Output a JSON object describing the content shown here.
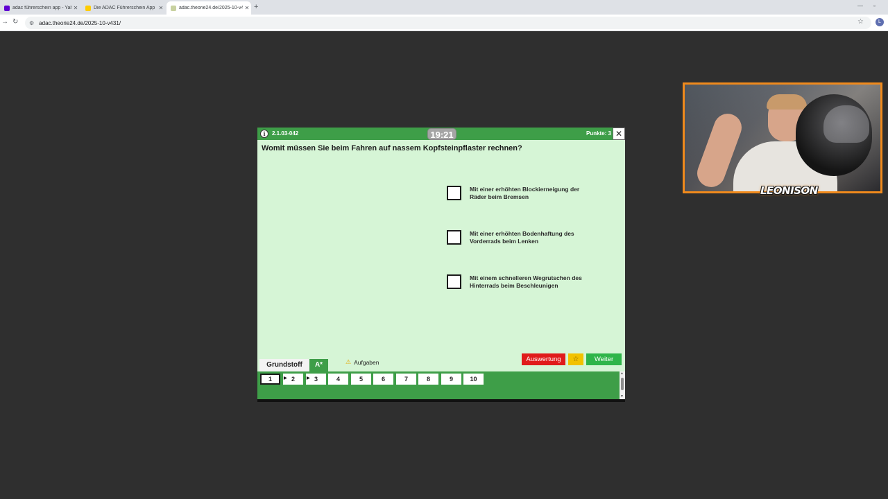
{
  "browser": {
    "tabs": [
      {
        "title": "adac führerschein app - Yahoo",
        "favicon_color": "#6001d2"
      },
      {
        "title": "Die ADAC Führerschein App",
        "favicon_color": "#ffcc00"
      },
      {
        "title": "adac.theorie24.de/2025-10-v4",
        "favicon_color": "#c8d1a0"
      }
    ],
    "active_tab": 2,
    "new_tab_label": "+",
    "close_label": "✕",
    "url": "adac.theorie24.de/2025-10-v431/",
    "profile_initial": "L"
  },
  "overlay": {
    "logo_text": "LEONISON",
    "border_color": "#f08a1c"
  },
  "exam": {
    "question_code": "2.1.03-042",
    "timer": "19:21",
    "points": "Punkte: 3",
    "close_label": "✕",
    "question": "Womit müssen Sie beim Fahren auf nassem Kopfsteinpflaster rechnen?",
    "answers": [
      {
        "text": "Mit einer erhöhten Blockierneigung der Räder beim Bremsen",
        "checked": false
      },
      {
        "text": "Mit einer erhöhten Bodenhaftung des Vorderrads beim Lenken",
        "checked": false
      },
      {
        "text": "Mit einem schnelleren Wegrutschen des Hinterrads beim Beschleunigen",
        "checked": false
      }
    ],
    "tab_grundstoff": "Grundstoff",
    "tab_class": "A*",
    "warning_label": "Aufgaben",
    "btn_auswertung": "Auswertung",
    "btn_favorite": "☆",
    "btn_next": "Weiter",
    "question_numbers": [
      "1",
      "2",
      "3",
      "4",
      "5",
      "6",
      "7",
      "8",
      "9",
      "10"
    ],
    "current_question": "1",
    "flagged": [
      "2",
      "3"
    ],
    "colors": {
      "green": "#3e9e48",
      "background": "#d6f5d6",
      "red": "#e01b1b",
      "yellow": "#f2c200",
      "next_green": "#2fb54a"
    }
  }
}
